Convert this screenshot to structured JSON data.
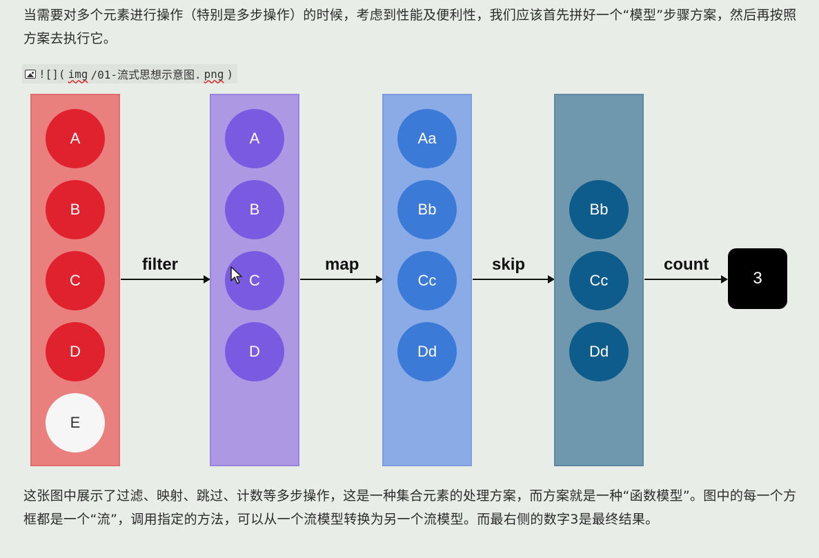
{
  "text": {
    "intro": "当需要对多个元素进行操作（特别是多步操作）的时候，考虑到性能及便利性，我们应该首先拼好一个“模型”步骤方案，然后再按照方案去执行它。",
    "image_ref_prefix": "![](",
    "image_ref_path_underlined": "img",
    "image_ref_path_rest": "/01-流式思想示意图.",
    "image_ref_ext": "png",
    "image_ref_suffix": ")",
    "explanation": "这张图中展示了过滤、映射、跳过、计数等多步操作，这是一种集合元素的处理方案，而方案就是一种“函数模型”。图中的每一个方框都是一个“流”，调用指定的方法，可以从一个流模型转换为另一个流模型。而最右侧的数字3是最终结果。"
  },
  "diagram": {
    "columns": [
      {
        "items": [
          "A",
          "B",
          "C",
          "D",
          "E"
        ],
        "color": "#e0222f",
        "background": "#e9807e"
      },
      {
        "items": [
          "A",
          "B",
          "C",
          "D"
        ],
        "color": "#7a5ae0",
        "background": "#ad98e4"
      },
      {
        "items": [
          "Aa",
          "Bb",
          "Cc",
          "Dd"
        ],
        "color": "#3c7ad8",
        "background": "#8aabe6"
      },
      {
        "items": [
          "Bb",
          "Cc",
          "Dd"
        ],
        "color": "#0e5c8c",
        "background": "#6f97ad"
      }
    ],
    "operations": [
      "filter",
      "map",
      "skip",
      "count"
    ],
    "result": "3"
  }
}
